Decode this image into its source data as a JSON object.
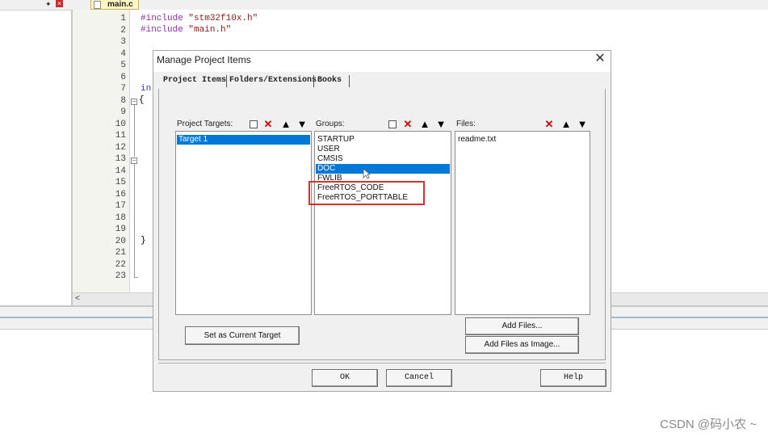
{
  "editor": {
    "tab_label": "main.c",
    "line_numbers": [
      "1",
      "2",
      "3",
      "4",
      "5",
      "6",
      "7",
      "8",
      "9",
      "10",
      "11",
      "12",
      "13",
      "14",
      "15",
      "16",
      "17",
      "18",
      "19",
      "20",
      "21",
      "22",
      "23"
    ],
    "code": {
      "line1_kw": "#include",
      "line1_str": "\"stm32f10x.h\"",
      "line2_kw": "#include",
      "line2_str": "\"main.h\"",
      "line7_partial": "in",
      "line8": "{",
      "line20": "}"
    },
    "scroll_left_glyph": "<"
  },
  "dialog": {
    "title": "Manage Project Items",
    "close_glyph": "✕",
    "tabs": [
      {
        "label": "Project Items",
        "active": true
      },
      {
        "label": "Folders/Extensions",
        "active": false
      },
      {
        "label": "Books",
        "active": false
      }
    ],
    "targets": {
      "header": "Project Targets:",
      "items": [
        {
          "label": "Target 1",
          "selected": true
        }
      ]
    },
    "groups": {
      "header": "Groups:",
      "items": [
        {
          "label": "STARTUP",
          "selected": false
        },
        {
          "label": "USER",
          "selected": false
        },
        {
          "label": "CMSIS",
          "selected": false
        },
        {
          "label": "DOC",
          "selected": true
        },
        {
          "label": "FWLIB",
          "selected": false
        },
        {
          "label": "FreeRTOS_CODE",
          "selected": false
        },
        {
          "label": "FreeRTOS_PORTTABLE",
          "selected": false
        }
      ]
    },
    "files": {
      "header": "Files:",
      "items": [
        {
          "label": "readme.txt",
          "selected": false
        }
      ]
    },
    "toolbar_glyphs": {
      "new": "",
      "delete": "✕",
      "up": "🡑",
      "down": "🡓"
    },
    "buttons": {
      "set_current_target": "Set as Current Target",
      "add_files": "Add Files...",
      "add_files_as_image": "Add Files as Image...",
      "ok": "OK",
      "cancel": "Cancel",
      "help": "Help"
    }
  },
  "watermark": "CSDN @码小农 ~",
  "colors": {
    "selection": "#0078d7",
    "highlight_box": "#d9312e",
    "delete_icon": "#d00000",
    "tab_active_bg": "#fff6c4"
  }
}
